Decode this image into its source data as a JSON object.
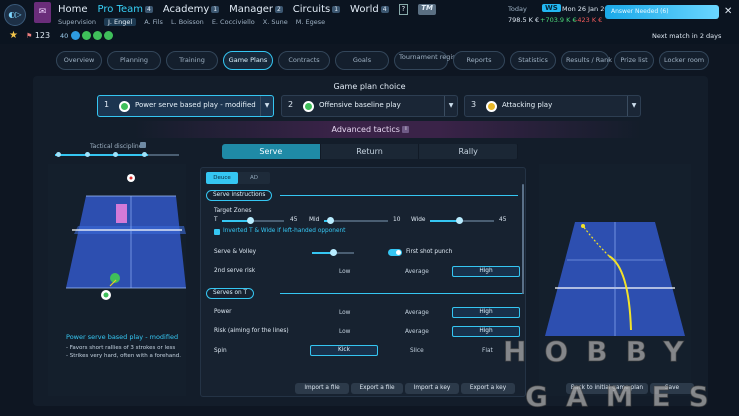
{
  "topbar": {
    "nav": [
      "Home",
      "Pro Team",
      "Academy",
      "Manager",
      "Circuits",
      "World"
    ],
    "nav_counts": {
      "pro_team": "4",
      "academy": "1",
      "manager": "2",
      "circuits": "1",
      "world": "4"
    },
    "help": "?",
    "tm": "TM",
    "subnav": [
      "Supervision",
      "J. Engel",
      "A. Fils",
      "L. Boisson",
      "E. Cocciviello",
      "X. Sune",
      "M. Egese"
    ],
    "today": "Today",
    "ws": "WS",
    "date": "Mon 26 Jan 26",
    "balance": "798.5 K €",
    "income": "+703.9 K €",
    "expense": "-423 K €",
    "answer_needed": "Answer Needed (6)",
    "close": "✕"
  },
  "secondbar": {
    "rank": "123",
    "points": "40",
    "next_match": "Next match in 2 days"
  },
  "tabs": [
    "Overview",
    "Planning",
    "Training",
    "Game Plans",
    "Contracts",
    "Goals",
    "Tournament registration",
    "Reports",
    "Statistics",
    "Results / Rank",
    "Prize list",
    "Locker room"
  ],
  "gameplan": {
    "title": "Game plan choice",
    "choices": [
      {
        "num": "1",
        "label": "Power serve based play - modified"
      },
      {
        "num": "2",
        "label": "Offensive baseline play"
      },
      {
        "num": "3",
        "label": "Attacking play"
      }
    ],
    "advanced": "Advanced tactics",
    "info": "i",
    "discipline": "Tactical discipline",
    "discipline_level": 0.75
  },
  "srtabs": [
    "Serve",
    "Return",
    "Rally"
  ],
  "deuce_ad": [
    "Deuce",
    "AD"
  ],
  "serve_instructions": {
    "title": "Serve instructions",
    "target_zones": "Target Zones",
    "t_label": "T",
    "t_val": "45",
    "t_level": 0.45,
    "mid_label": "Mid",
    "mid_val": "10",
    "mid_level": 0.1,
    "wide_label": "Wide",
    "wide_val": "45",
    "wide_level": 0.45,
    "inverted": "Inverted T & Wide if left-handed opponent",
    "serve_volley": "Serve & Volley",
    "serve_volley_level": 0.5,
    "first_shot_punch": "First shot punch",
    "second_serve_risk": "2nd serve risk",
    "low": "Low",
    "average": "Average",
    "high": "High"
  },
  "serves_on_t": {
    "title": "Serves on T",
    "power": "Power",
    "risk": "Risk (aiming for the lines)",
    "spin": "Spin",
    "low": "Low",
    "average": "Average",
    "high": "High",
    "kick": "Kick",
    "slice": "Slice",
    "flat": "Flat"
  },
  "caption": {
    "title": "Power serve based play - modified",
    "line1": "- Favors short rallies of 3 strokes or less",
    "line2": "- Strikes very hard, often with a forehand."
  },
  "buttons": [
    "Import a file",
    "Export a file",
    "Import a key",
    "Export a key",
    "Back to initial game plan",
    "Save"
  ],
  "watermark": {
    "line1": "HOBBY",
    "line2": "GAMES"
  },
  "colors": {
    "accent": "#35c6f2",
    "background": "#0e1622",
    "panel": "#131d2a",
    "court": "#2d5fc4"
  }
}
